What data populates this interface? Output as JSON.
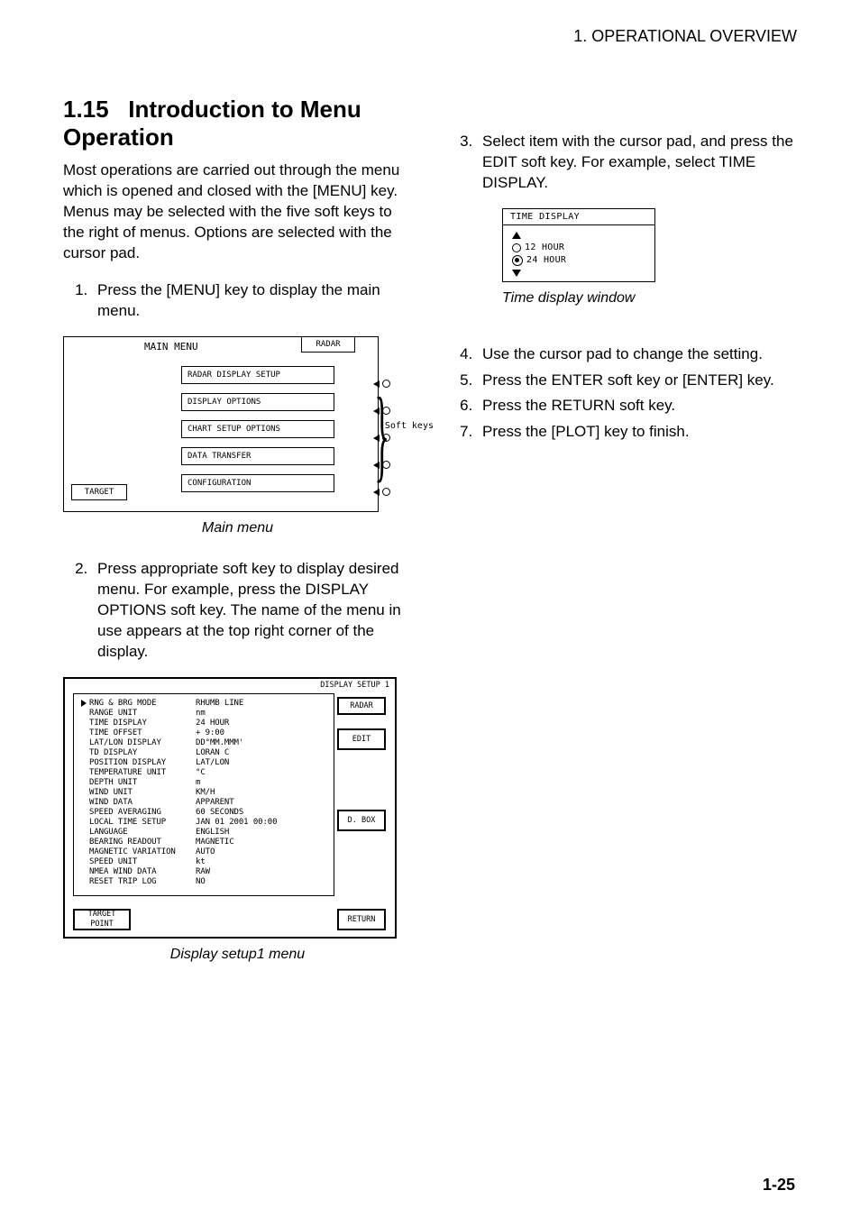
{
  "header": "1.  OPERATIONAL OVERVIEW",
  "section_number": "1.15",
  "section_title": "Introduction to Menu Operation",
  "para1": "Most operations are carried out through the menu which is opened and closed with the [MENU] key. Menus may be selected with the five soft keys to the right of menus. Options are selected with the cursor pad.",
  "steps_left": {
    "s1": "Press the [MENU] key to display the main menu.",
    "s2": "Press appropriate soft key to display desired menu. For example, press the DISPLAY OPTIONS soft key. The name of the menu in use appears at the top right corner of the display."
  },
  "mainmenu": {
    "title": "MAIN MENU",
    "radar": "RADAR",
    "btns": [
      "RADAR DISPLAY SETUP",
      "DISPLAY OPTIONS",
      "CHART SETUP OPTIONS",
      "DATA TRANSFER",
      "CONFIGURATION"
    ],
    "page_btn": "TARGET",
    "softkey_label": "Soft keys"
  },
  "caption_mainmenu": "Main menu",
  "dispopt": {
    "menuname": "DISPLAY SETUP 1",
    "rows": [
      {
        "label": "RNG & BRG MODE",
        "val": "RHUMB LINE"
      },
      {
        "label": "RANGE UNIT",
        "val": "nm"
      },
      {
        "label": "TIME DISPLAY",
        "val": "24 HOUR"
      },
      {
        "label": "TIME OFFSET",
        "val": "+ 9:00"
      },
      {
        "label": "LAT/LON DISPLAY",
        "val": "DD°MM.MMM'"
      },
      {
        "label": "TD DISPLAY",
        "val": "LORAN C"
      },
      {
        "label": "POSITION DISPLAY",
        "val": "LAT/LON"
      },
      {
        "label": "TEMPERATURE UNIT",
        "val": "°C"
      },
      {
        "label": "DEPTH UNIT",
        "val": "m"
      },
      {
        "label": "WIND UNIT",
        "val": "KM/H"
      },
      {
        "label": "WIND DATA",
        "val": "APPARENT"
      },
      {
        "label": "SPEED AVERAGING",
        "val": "60 SECONDS"
      },
      {
        "label": "LOCAL TIME SETUP",
        "val": "JAN 01 2001 00:00"
      },
      {
        "label": "LANGUAGE",
        "val": "ENGLISH"
      },
      {
        "label": "BEARING READOUT",
        "val": "MAGNETIC"
      },
      {
        "label": "MAGNETIC VARIATION",
        "val": "AUTO"
      },
      {
        "label": "SPEED UNIT",
        "val": "kt"
      },
      {
        "label": "NMEA WIND DATA",
        "val": "RAW"
      },
      {
        "label": "RESET TRIP LOG",
        "val": "NO"
      }
    ],
    "soft_a": "RADAR",
    "soft_b": "EDIT",
    "soft_c": "D. BOX",
    "soft_d": "RETURN",
    "bottom_btn": "TARGET POINT"
  },
  "caption_dispopt": "Display setup1 menu",
  "steps_right": {
    "s3": "Select item with the cursor pad, and press the EDIT soft key. For example, select TIME DISPLAY.",
    "s4": "Use the cursor pad to change the setting.",
    "s5": "Press the ENTER soft key or [ENTER] key.",
    "s6": "Press the RETURN soft key.",
    "s7": "Press the [PLOT] key to finish."
  },
  "cursorpad": {
    "header": "TIME DISPLAY",
    "opt1": "12 HOUR",
    "opt2": "24 HOUR"
  },
  "caption_cursorpad": "Time display window",
  "page_number": "1-25"
}
